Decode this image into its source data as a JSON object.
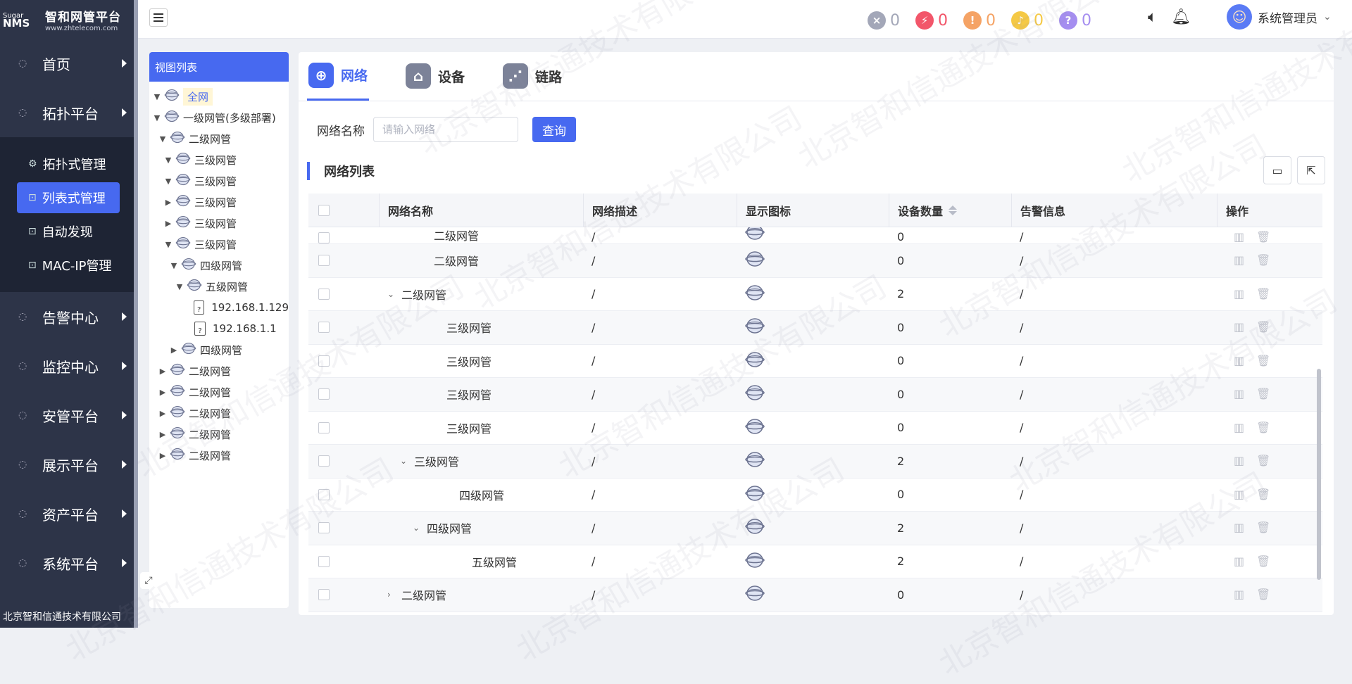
{
  "app": {
    "logo_small": "Sugar",
    "logo_nms": "NMS",
    "title": "智和网管平台",
    "url": "www.zhtelecom.com",
    "footer": "北京智和信通技术有限公司",
    "watermark": "北京智和信通技术有限公司"
  },
  "sidebar": {
    "items": [
      {
        "label": "首页",
        "icon": "home-icon"
      },
      {
        "label": "拓扑平台",
        "icon": "drop-icon"
      }
    ],
    "submenu": [
      {
        "label": "拓扑式管理",
        "icon": "gear-icon",
        "active": false
      },
      {
        "label": "列表式管理",
        "icon": "trash-icon",
        "active": true
      },
      {
        "label": "自动发现",
        "icon": "trash-icon",
        "active": false
      },
      {
        "label": "MAC-IP管理",
        "icon": "trash-icon",
        "active": false
      }
    ],
    "items2": [
      {
        "label": "告警中心",
        "icon": "drop-icon"
      },
      {
        "label": "监控中心",
        "icon": "gear-icon"
      },
      {
        "label": "安管平台",
        "icon": "gear-icon"
      },
      {
        "label": "展示平台",
        "icon": "gear-icon"
      },
      {
        "label": "资产平台",
        "icon": "phone-icon"
      },
      {
        "label": "系统平台",
        "icon": "trash-icon"
      }
    ]
  },
  "topbar": {
    "alarms": [
      {
        "name": "cleared",
        "glyph": "×",
        "count": "0",
        "color": "#a3a7b8"
      },
      {
        "name": "critical",
        "glyph": "⚡",
        "count": "0",
        "color": "#f2566a"
      },
      {
        "name": "major",
        "glyph": "!",
        "count": "0",
        "color": "#f5a365"
      },
      {
        "name": "minor",
        "glyph": "♪",
        "count": "0",
        "color": "#f5c945"
      },
      {
        "name": "unknown",
        "glyph": "?",
        "count": "0",
        "color": "#a58ef0"
      }
    ],
    "user": "系统管理员"
  },
  "tree": {
    "header": "视图列表",
    "nodes": [
      {
        "label": "全网",
        "level": 0,
        "toggle": "open",
        "selected": true
      },
      {
        "label": "一级网管(多级部署)",
        "level": 0,
        "toggle": "open"
      },
      {
        "label": "二级网管",
        "level": 1,
        "toggle": "open"
      },
      {
        "label": "三级网管",
        "level": 2,
        "toggle": "open"
      },
      {
        "label": "三级网管",
        "level": 2,
        "toggle": "open"
      },
      {
        "label": "三级网管",
        "level": 2,
        "toggle": "closed"
      },
      {
        "label": "三级网管",
        "level": 2,
        "toggle": "closed"
      },
      {
        "label": "三级网管",
        "level": 2,
        "toggle": "open"
      },
      {
        "label": "四级网管",
        "level": 3,
        "toggle": "open"
      },
      {
        "label": "五级网管",
        "level": 4,
        "toggle": "open"
      },
      {
        "label": "192.168.1.129",
        "level": 5,
        "toggle": "none",
        "file": true
      },
      {
        "label": "192.168.1.1",
        "level": 5,
        "toggle": "none",
        "file": true
      },
      {
        "label": "四级网管",
        "level": 3,
        "toggle": "closed"
      },
      {
        "label": "二级网管",
        "level": 1,
        "toggle": "closed"
      },
      {
        "label": "二级网管",
        "level": 1,
        "toggle": "closed"
      },
      {
        "label": "二级网管",
        "level": 1,
        "toggle": "closed"
      },
      {
        "label": "二级网管",
        "level": 1,
        "toggle": "closed"
      },
      {
        "label": "二级网管",
        "level": 1,
        "toggle": "closed"
      }
    ]
  },
  "tabs": [
    {
      "label": "网络",
      "icon": "globe-icon",
      "active": true
    },
    {
      "label": "设备",
      "icon": "router-icon",
      "active": false
    },
    {
      "label": "链路",
      "icon": "link-icon",
      "active": false
    }
  ],
  "search": {
    "label": "网络名称",
    "placeholder": "请输入网络",
    "button": "查询"
  },
  "list": {
    "title": "网络列表",
    "columns": [
      "网络名称",
      "网络描述",
      "显示图标",
      "设备数量",
      "告警信息",
      "操作"
    ],
    "rows": [
      {
        "name": "二级网管",
        "indent": 1,
        "expand": "",
        "desc": "/",
        "count": "0",
        "alarm": "/",
        "partial": true
      },
      {
        "name": "二级网管",
        "indent": 1,
        "expand": "",
        "desc": "/",
        "count": "0",
        "alarm": "/"
      },
      {
        "name": "二级网管",
        "indent": 0,
        "expand": "open",
        "desc": "/",
        "count": "2",
        "alarm": "/"
      },
      {
        "name": "三级网管",
        "indent": 2,
        "expand": "",
        "desc": "/",
        "count": "0",
        "alarm": "/"
      },
      {
        "name": "三级网管",
        "indent": 2,
        "expand": "",
        "desc": "/",
        "count": "0",
        "alarm": "/"
      },
      {
        "name": "三级网管",
        "indent": 2,
        "expand": "",
        "desc": "/",
        "count": "0",
        "alarm": "/"
      },
      {
        "name": "三级网管",
        "indent": 2,
        "expand": "",
        "desc": "/",
        "count": "0",
        "alarm": "/"
      },
      {
        "name": "三级网管",
        "indent": 1,
        "expand": "open",
        "desc": "/",
        "count": "2",
        "alarm": "/"
      },
      {
        "name": "四级网管",
        "indent": 3,
        "expand": "",
        "desc": "/",
        "count": "0",
        "alarm": "/"
      },
      {
        "name": "四级网管",
        "indent": 2,
        "expand": "open",
        "desc": "/",
        "count": "2",
        "alarm": "/"
      },
      {
        "name": "五级网管",
        "indent": 4,
        "expand": "",
        "desc": "/",
        "count": "2",
        "alarm": "/"
      },
      {
        "name": "二级网管",
        "indent": 0,
        "expand": "closed",
        "desc": "/",
        "count": "0",
        "alarm": "/"
      }
    ]
  }
}
